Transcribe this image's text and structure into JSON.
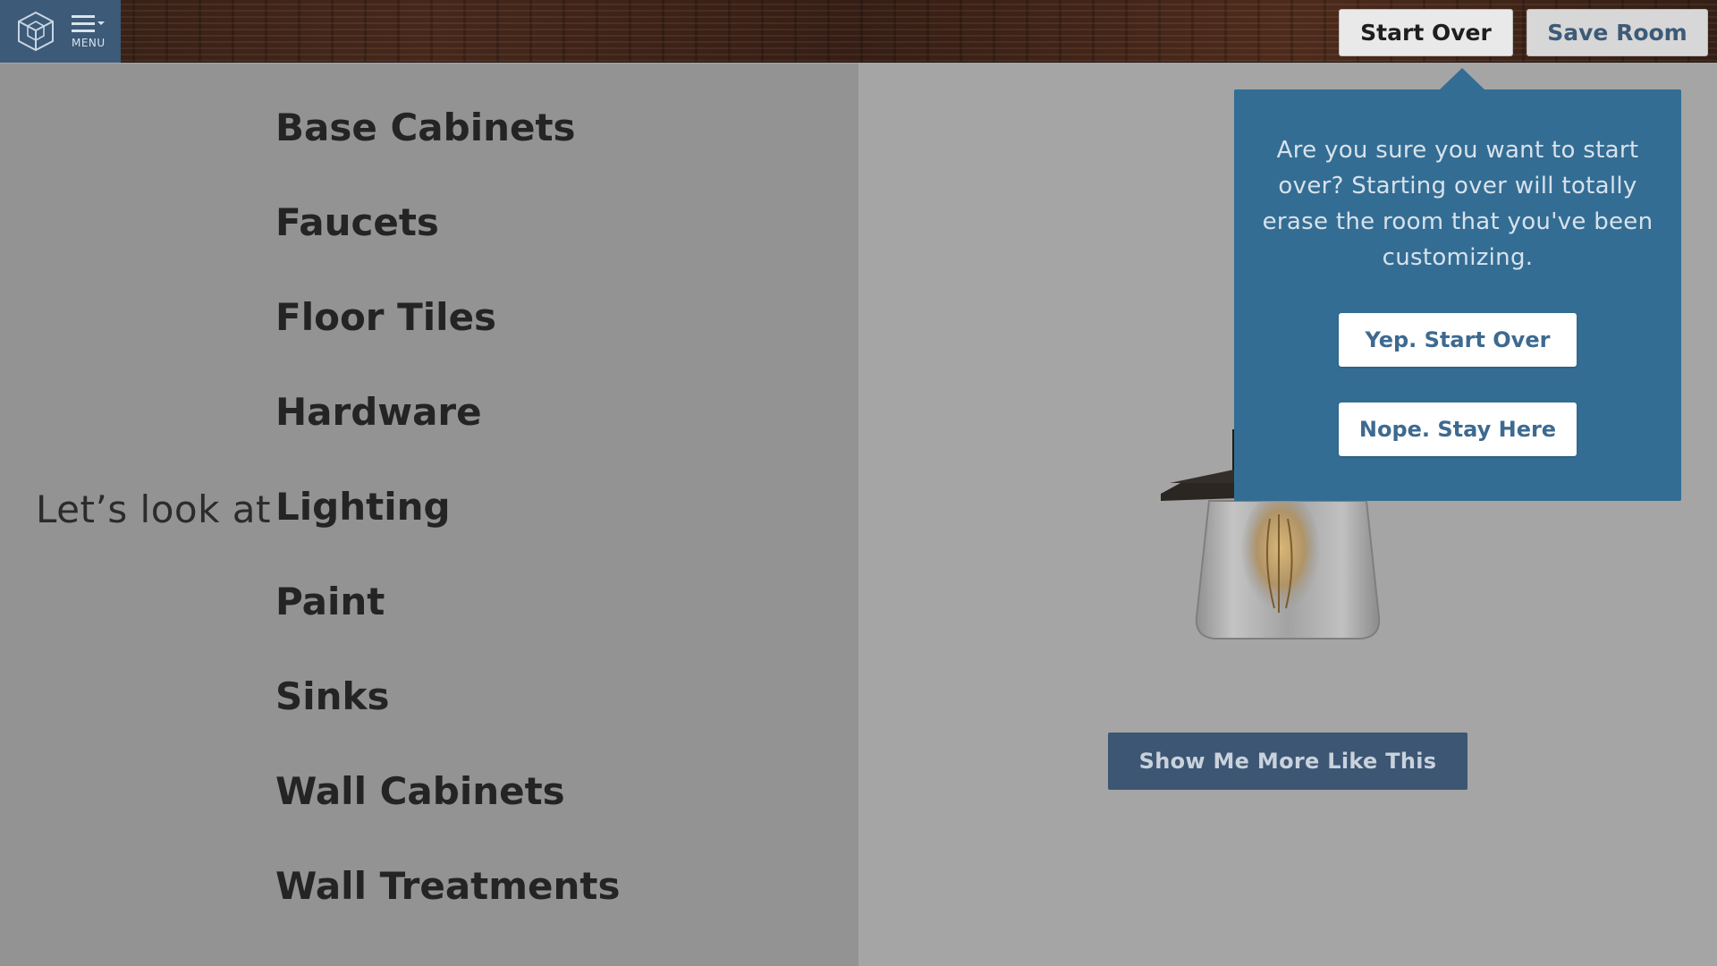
{
  "header": {
    "menu_label": "MENU",
    "start_over_label": "Start Over",
    "save_room_label": "Save Room"
  },
  "left": {
    "prompt": "Let’s look at",
    "categories": [
      "Base Cabinets",
      "Faucets",
      "Floor Tiles",
      "Hardware",
      "Lighting",
      "Paint",
      "Sinks",
      "Wall Cabinets",
      "Wall Treatments"
    ]
  },
  "product": {
    "icon": "pendant-lamp-image",
    "more_button_label": "Show Me More Like This"
  },
  "dialog": {
    "message": "Are you sure you want to start over? Starting over will totally erase the room that you've been customizing.",
    "confirm_label": "Yep. Start Over",
    "cancel_label": "Nope. Stay Here"
  },
  "colors": {
    "accent": "#346d93",
    "menu_bg": "#3d5a78",
    "button_dark": "#3c5674"
  }
}
